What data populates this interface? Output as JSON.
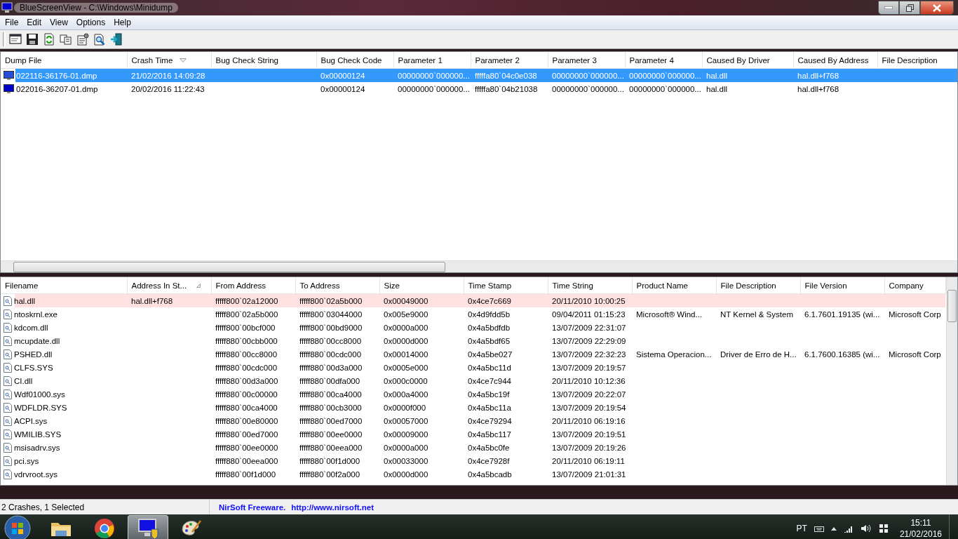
{
  "window": {
    "title": "BlueScreenView  -  C:\\Windows\\Minidump"
  },
  "menu": [
    "File",
    "Edit",
    "View",
    "Options",
    "Help"
  ],
  "crash_list": {
    "columns": [
      {
        "label": "Dump File",
        "sorted": false
      },
      {
        "label": "Crash Time",
        "sorted": true
      },
      {
        "label": "Bug Check String",
        "sorted": false
      },
      {
        "label": "Bug Check Code",
        "sorted": false
      },
      {
        "label": "Parameter 1",
        "sorted": false
      },
      {
        "label": "Parameter 2",
        "sorted": false
      },
      {
        "label": "Parameter 3",
        "sorted": false
      },
      {
        "label": "Parameter 4",
        "sorted": false
      },
      {
        "label": "Caused By Driver",
        "sorted": false
      },
      {
        "label": "Caused By Address",
        "sorted": false
      },
      {
        "label": "File Description",
        "sorted": false
      }
    ],
    "rows": [
      {
        "selected": true,
        "cells": [
          "022116-36176-01.dmp",
          "21/02/2016 14:09:28",
          null,
          "0x00000124",
          "00000000`000000...",
          "fffffa80`04c0e038",
          "00000000`000000...",
          "00000000`000000...",
          "hal.dll",
          "hal.dll+f768",
          null
        ]
      },
      {
        "selected": false,
        "cells": [
          "022016-36207-01.dmp",
          "20/02/2016 11:22:43",
          null,
          "0x00000124",
          "00000000`000000...",
          "fffffa80`04b21038",
          "00000000`000000...",
          "00000000`000000...",
          "hal.dll",
          "hal.dll+f768",
          null
        ]
      }
    ]
  },
  "module_list": {
    "columns": [
      {
        "label": "Filename",
        "sorted": false
      },
      {
        "label": "Address In St...",
        "sorted": true
      },
      {
        "label": "From Address",
        "sorted": false
      },
      {
        "label": "To Address",
        "sorted": false
      },
      {
        "label": "Size",
        "sorted": false
      },
      {
        "label": "Time Stamp",
        "sorted": false
      },
      {
        "label": "Time String",
        "sorted": false
      },
      {
        "label": "Product Name",
        "sorted": false
      },
      {
        "label": "File Description",
        "sorted": false
      },
      {
        "label": "File Version",
        "sorted": false
      },
      {
        "label": "Company",
        "sorted": false
      }
    ],
    "rows": [
      {
        "in_stack": true,
        "cells": [
          "hal.dll",
          "hal.dll+f768",
          "fffff800`02a12000",
          "fffff800`02a5b000",
          "0x00049000",
          "0x4ce7c669",
          "20/11/2010 10:00:25",
          null,
          null,
          null,
          null
        ]
      },
      {
        "in_stack": false,
        "cells": [
          "ntoskrnl.exe",
          null,
          "fffff800`02a5b000",
          "fffff800`03044000",
          "0x005e9000",
          "0x4d9fdd5b",
          "09/04/2011 01:15:23",
          "Microsoft® Wind...",
          "NT Kernel & System",
          "6.1.7601.19135 (wi...",
          "Microsoft Corp"
        ]
      },
      {
        "in_stack": false,
        "cells": [
          "kdcom.dll",
          null,
          "fffff800`00bcf000",
          "fffff800`00bd9000",
          "0x0000a000",
          "0x4a5bdfdb",
          "13/07/2009 22:31:07",
          null,
          null,
          null,
          null
        ]
      },
      {
        "in_stack": false,
        "cells": [
          "mcupdate.dll",
          null,
          "fffff880`00cbb000",
          "fffff880`00cc8000",
          "0x0000d000",
          "0x4a5bdf65",
          "13/07/2009 22:29:09",
          null,
          null,
          null,
          null
        ]
      },
      {
        "in_stack": false,
        "cells": [
          "PSHED.dll",
          null,
          "fffff880`00cc8000",
          "fffff880`00cdc000",
          "0x00014000",
          "0x4a5be027",
          "13/07/2009 22:32:23",
          "Sistema Operacion...",
          "Driver de Erro de H...",
          "6.1.7600.16385 (wi...",
          "Microsoft Corp"
        ]
      },
      {
        "in_stack": false,
        "cells": [
          "CLFS.SYS",
          null,
          "fffff880`00cdc000",
          "fffff880`00d3a000",
          "0x0005e000",
          "0x4a5bc11d",
          "13/07/2009 20:19:57",
          null,
          null,
          null,
          null
        ]
      },
      {
        "in_stack": false,
        "cells": [
          "CI.dll",
          null,
          "fffff880`00d3a000",
          "fffff880`00dfa000",
          "0x000c0000",
          "0x4ce7c944",
          "20/11/2010 10:12:36",
          null,
          null,
          null,
          null
        ]
      },
      {
        "in_stack": false,
        "cells": [
          "Wdf01000.sys",
          null,
          "fffff880`00c00000",
          "fffff880`00ca4000",
          "0x000a4000",
          "0x4a5bc19f",
          "13/07/2009 20:22:07",
          null,
          null,
          null,
          null
        ]
      },
      {
        "in_stack": false,
        "cells": [
          "WDFLDR.SYS",
          null,
          "fffff880`00ca4000",
          "fffff880`00cb3000",
          "0x0000f000",
          "0x4a5bc11a",
          "13/07/2009 20:19:54",
          null,
          null,
          null,
          null
        ]
      },
      {
        "in_stack": false,
        "cells": [
          "ACPI.sys",
          null,
          "fffff880`00e80000",
          "fffff880`00ed7000",
          "0x00057000",
          "0x4ce79294",
          "20/11/2010 06:19:16",
          null,
          null,
          null,
          null
        ]
      },
      {
        "in_stack": false,
        "cells": [
          "WMILIB.SYS",
          null,
          "fffff880`00ed7000",
          "fffff880`00ee0000",
          "0x00009000",
          "0x4a5bc117",
          "13/07/2009 20:19:51",
          null,
          null,
          null,
          null
        ]
      },
      {
        "in_stack": false,
        "cells": [
          "msisadrv.sys",
          null,
          "fffff880`00ee0000",
          "fffff880`00eea000",
          "0x0000a000",
          "0x4a5bc0fe",
          "13/07/2009 20:19:26",
          null,
          null,
          null,
          null
        ]
      },
      {
        "in_stack": false,
        "cells": [
          "pci.sys",
          null,
          "fffff880`00eea000",
          "fffff880`00f1d000",
          "0x00033000",
          "0x4ce7928f",
          "20/11/2010 06:19:11",
          null,
          null,
          null,
          null
        ]
      },
      {
        "in_stack": false,
        "cells": [
          "vdrvroot.sys",
          null,
          "fffff880`00f1d000",
          "fffff880`00f2a000",
          "0x0000d000",
          "0x4a5bcadb",
          "13/07/2009 21:01:31",
          null,
          null,
          null,
          null
        ]
      }
    ]
  },
  "status_bar": {
    "summary": "2 Crashes, 1 Selected",
    "credit": "NirSoft Freeware.",
    "link": "http://www.nirsoft.net"
  },
  "taskbar": {
    "apps": [
      {
        "active": false
      },
      {
        "active": false
      },
      {
        "active": true
      },
      {
        "active": false
      }
    ],
    "tray": {
      "language": "PT",
      "time": "15:11",
      "date": "21/02/2016"
    }
  }
}
